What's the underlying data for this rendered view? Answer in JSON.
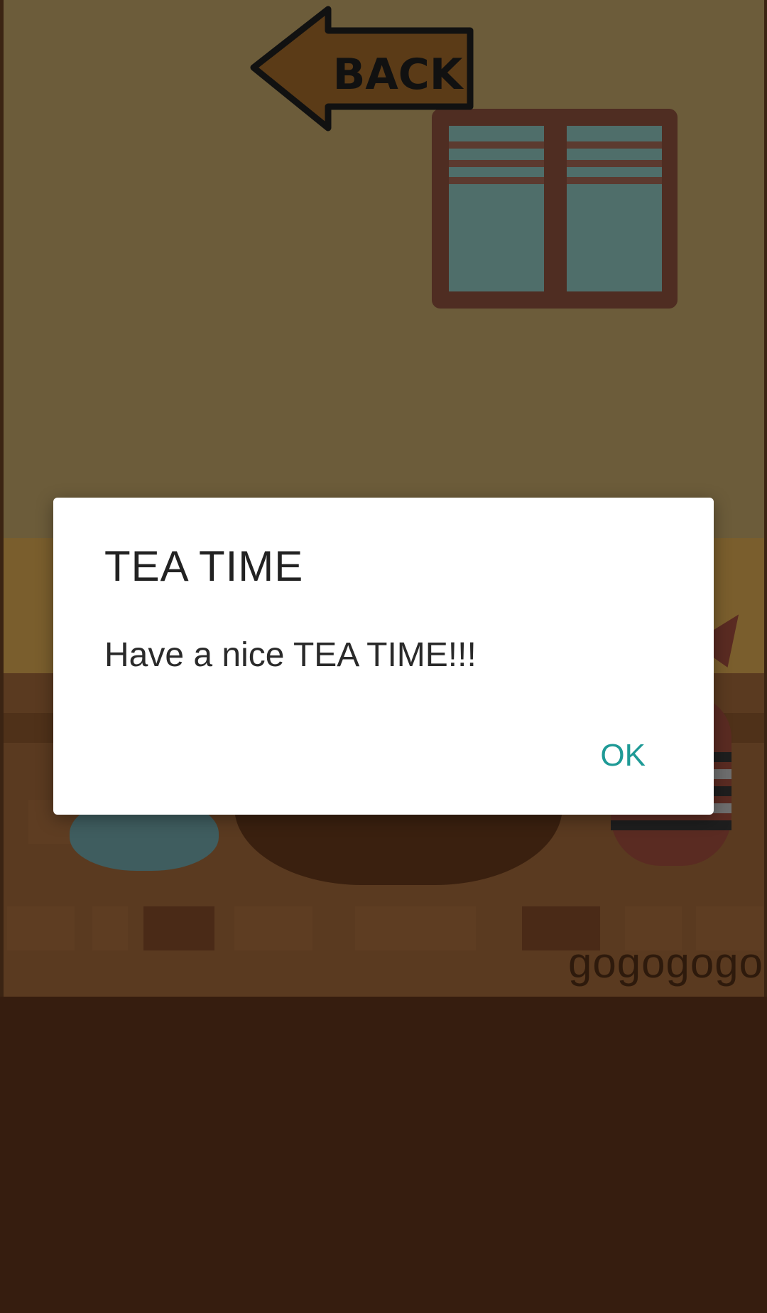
{
  "back_button": {
    "label": "BACK",
    "icon": "back-arrow-icon"
  },
  "scene": {
    "watermark": "gogogogo"
  },
  "dialog": {
    "title": "TEA TIME",
    "message": "Have a nice TEA TIME!!!",
    "ok_label": "OK"
  },
  "colors": {
    "accent": "#1e9a96",
    "dialog_background": "#ffffff",
    "scene_ground": "#361d0f"
  }
}
